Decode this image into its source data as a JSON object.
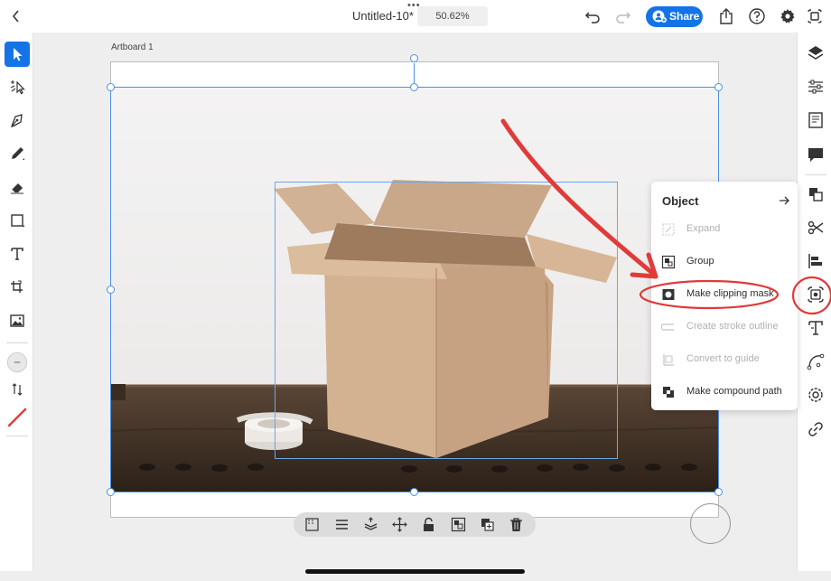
{
  "document": {
    "title": "Untitled-10*",
    "zoom": "50.62%",
    "share_label": "Share",
    "artboard_name": "Artboard 1"
  },
  "left_tools": [
    {
      "name": "select-tool",
      "icon": "arrow-pointer-icon",
      "active": true
    },
    {
      "name": "direct-select-tool",
      "icon": "direct-select-icon"
    },
    {
      "name": "pen-tool",
      "icon": "pen-nib-icon"
    },
    {
      "name": "pencil-tool",
      "icon": "pencil-icon"
    },
    {
      "name": "eraser-tool",
      "icon": "eraser-icon"
    },
    {
      "name": "shape-tool",
      "icon": "square-icon"
    },
    {
      "name": "type-tool",
      "icon": "text-T-icon"
    },
    {
      "name": "transform-tool",
      "icon": "crop-transform-icon"
    },
    {
      "name": "place-image-tool",
      "icon": "image-icon"
    },
    {
      "name": "fill-swatch",
      "icon": "fill-circle-icon"
    },
    {
      "name": "swap-fill-stroke",
      "icon": "swap-arrows-icon"
    },
    {
      "name": "stroke-swatch",
      "icon": "stroke-slash-icon",
      "color": "#e03a3a"
    }
  ],
  "right_tools": [
    {
      "name": "layers",
      "icon": "layers-icon"
    },
    {
      "name": "properties",
      "icon": "sliders-icon"
    },
    {
      "name": "libraries",
      "icon": "book-icon"
    },
    {
      "name": "comments",
      "icon": "comment-icon"
    },
    {
      "name": "arrange",
      "icon": "arrange-icon"
    },
    {
      "name": "combine-shapes",
      "icon": "scissors-icon"
    },
    {
      "name": "align",
      "icon": "align-left-icon"
    },
    {
      "name": "object",
      "icon": "object-icon",
      "active": true
    },
    {
      "name": "type-properties",
      "icon": "type-icon"
    },
    {
      "name": "path",
      "icon": "path-curve-icon"
    },
    {
      "name": "repeat",
      "icon": "gear-repeat-icon"
    },
    {
      "name": "links",
      "icon": "link-icon"
    }
  ],
  "object_menu": {
    "title": "Object",
    "items": [
      {
        "label": "Expand",
        "icon": "expand-icon",
        "enabled": false
      },
      {
        "label": "Group",
        "icon": "group-icon",
        "enabled": true
      },
      {
        "label": "Make clipping mask",
        "icon": "clipping-mask-icon",
        "enabled": true,
        "highlighted": true
      },
      {
        "label": "Create stroke outline",
        "icon": "stroke-outline-icon",
        "enabled": false
      },
      {
        "label": "Convert to guide",
        "icon": "guide-icon",
        "enabled": false
      },
      {
        "label": "Make compound path",
        "icon": "compound-path-icon",
        "enabled": true
      }
    ]
  },
  "action_bar": [
    {
      "name": "mask-action",
      "icon": "mask-icon"
    },
    {
      "name": "align-action",
      "icon": "lines-icon"
    },
    {
      "name": "arrange-action",
      "icon": "stack-icon"
    },
    {
      "name": "move-action",
      "icon": "move-icon"
    },
    {
      "name": "lock-action",
      "icon": "lock-icon"
    },
    {
      "name": "group-action",
      "icon": "group-icon"
    },
    {
      "name": "duplicate-action",
      "icon": "duplicate-icon"
    },
    {
      "name": "delete-action",
      "icon": "trash-icon"
    }
  ],
  "colors": {
    "accent": "#1473e6",
    "annotation": "#e03a3a",
    "selection": "#4a90e2"
  }
}
